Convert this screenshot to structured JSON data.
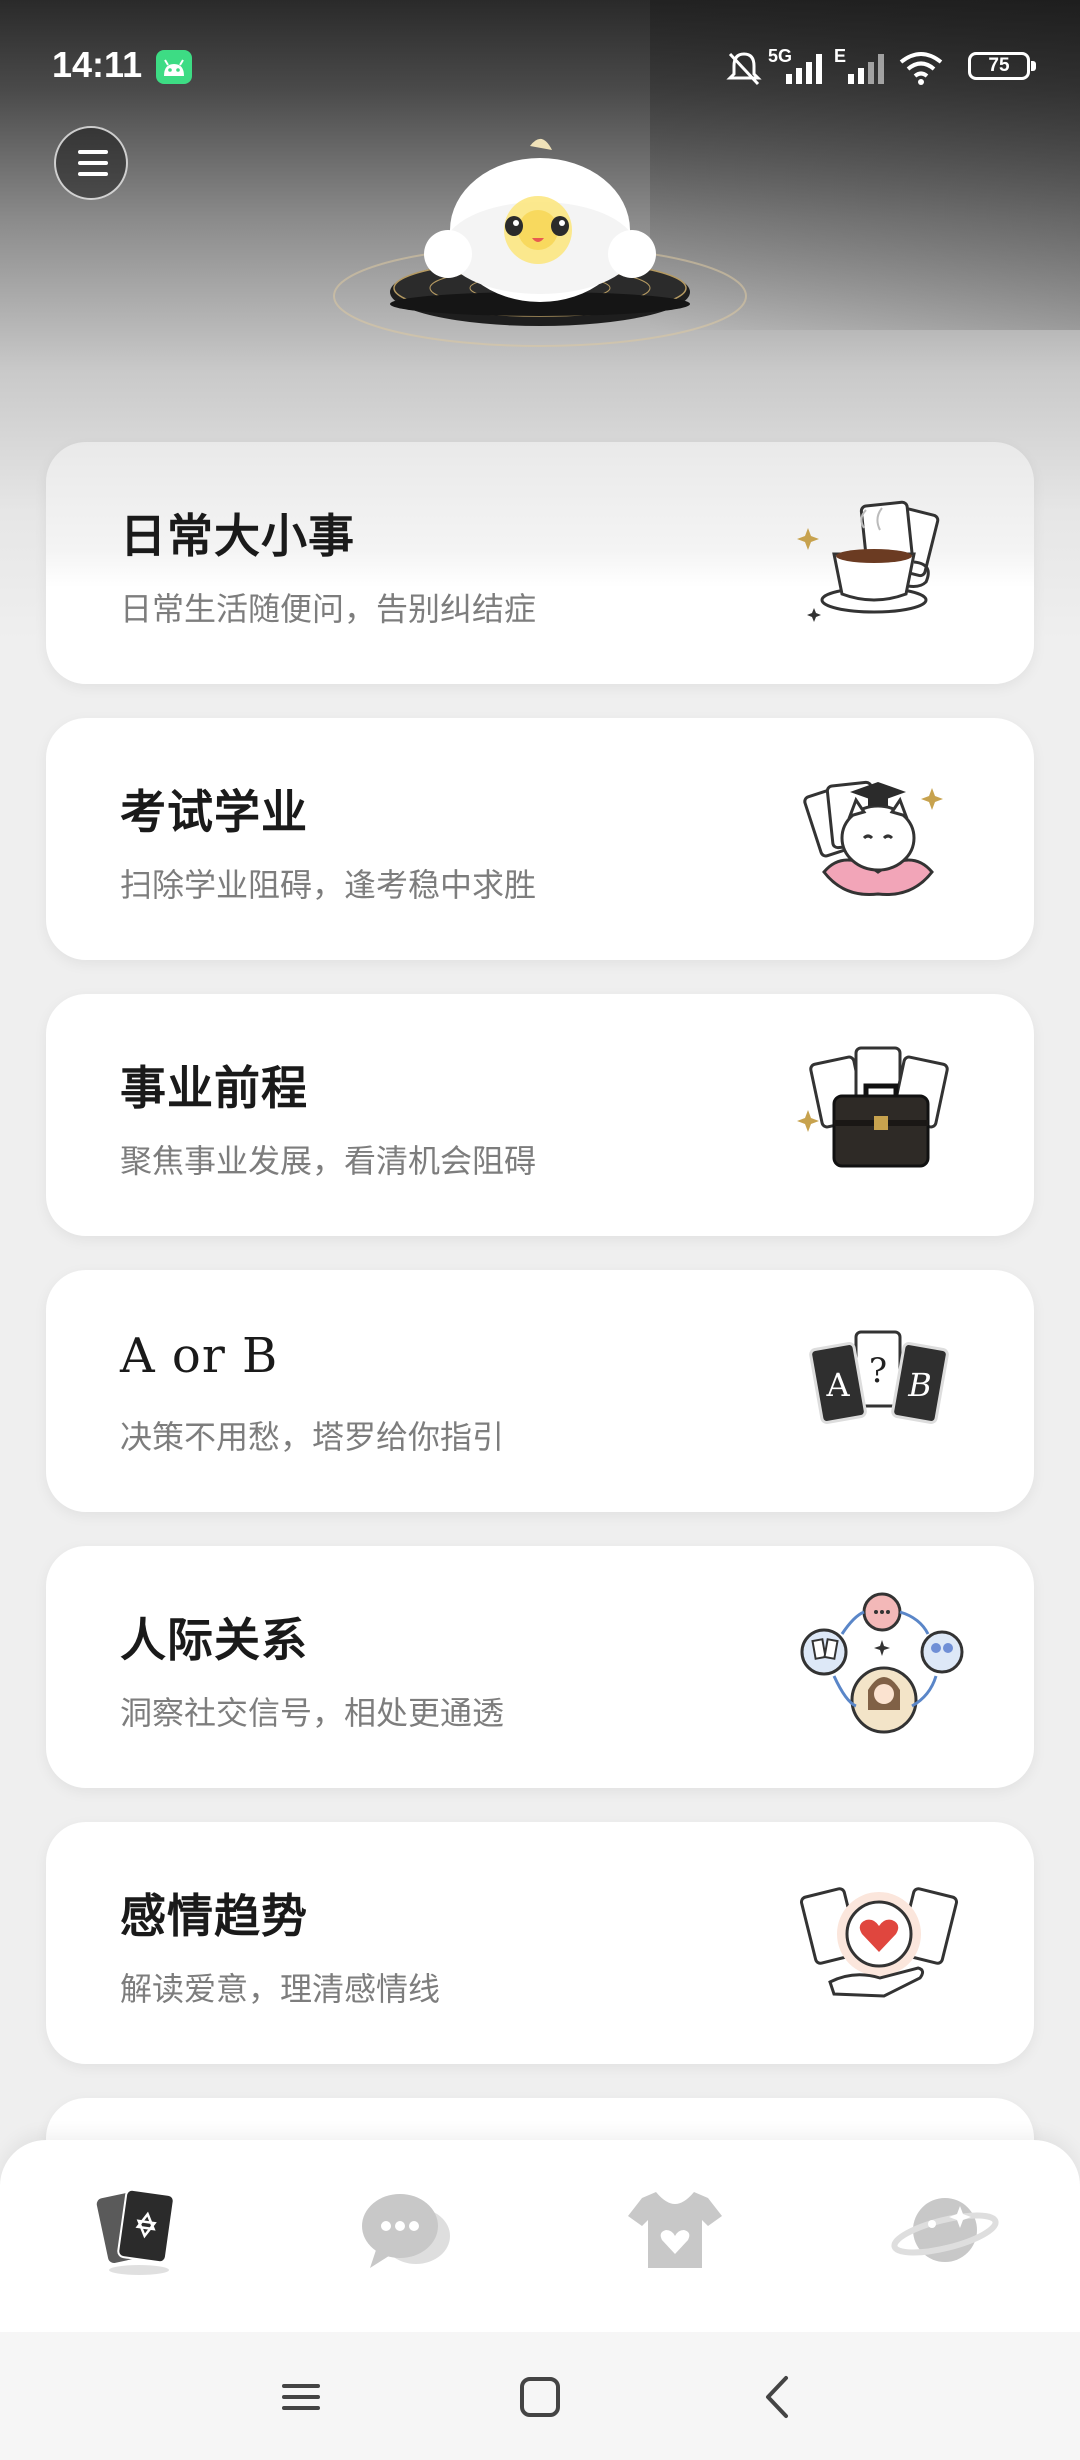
{
  "status_bar": {
    "time": "14:11",
    "network_label": "5G",
    "secondary_network_label": "E",
    "battery": "75"
  },
  "header": {
    "menu_icon": "hamburger-icon",
    "mascot": "fluffy-chick-mascot"
  },
  "cards": [
    {
      "title": "日常大小事",
      "subtitle": "日常生活随便问，告别纠结症",
      "illustration": "coffee-cup-with-cards-icon"
    },
    {
      "title": "考试学业",
      "subtitle": "扫除学业阻碍，逢考稳中求胜",
      "illustration": "graduate-cat-on-lotus-icon"
    },
    {
      "title": "事业前程",
      "subtitle": "聚焦事业发展，看清机会阻碍",
      "illustration": "briefcase-with-cards-icon"
    },
    {
      "title": "A or B",
      "subtitle": "决策不用愁，塔罗给你指引",
      "illustration": "a-question-b-cards-icon"
    },
    {
      "title": "人际关系",
      "subtitle": "洞察社交信号，相处更通透",
      "illustration": "social-cycle-icon"
    },
    {
      "title": "感情趋势",
      "subtitle": "解读爱意，理清感情线",
      "illustration": "heart-in-hand-with-cards-icon"
    }
  ],
  "bottom_nav": [
    {
      "name": "tarot-cards-icon",
      "active": true
    },
    {
      "name": "chat-bubbles-icon",
      "active": false
    },
    {
      "name": "tshirt-heart-icon",
      "active": false
    },
    {
      "name": "planet-icon",
      "active": false
    }
  ],
  "system_nav": [
    "recents-icon",
    "home-icon",
    "back-icon"
  ],
  "colors": {
    "card_background": "#ffffff",
    "title_text": "#1a1a1a",
    "subtitle_text": "#7d7d7d",
    "inactive_nav_icon": "#c8c8c8",
    "active_nav_icon": "#2b2b2b"
  }
}
